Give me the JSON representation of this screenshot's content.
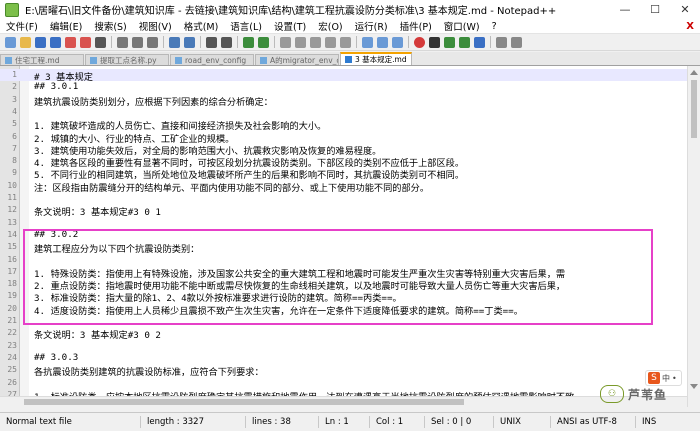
{
  "window": {
    "title": "E:\\居曜石\\旧文件备份\\建筑知识库 - 去链接\\建筑知识库\\结构\\建筑工程抗震设防分类标准\\3  基本规定.md - Notepad++",
    "min": "—",
    "max": "☐",
    "close": "✕"
  },
  "menu": [
    "文件(F)",
    "编辑(E)",
    "搜索(S)",
    "视图(V)",
    "格式(M)",
    "语言(L)",
    "设置(T)",
    "宏(O)",
    "运行(R)",
    "插件(P)",
    "窗口(W)",
    "?"
  ],
  "menu_close": "X",
  "tabs": [
    {
      "label": "住宅工程.md"
    },
    {
      "label": "提取工点名称.py"
    },
    {
      "label": "road_env_config"
    },
    {
      "label": "A的migrator_env_config"
    },
    {
      "label": "3  基本规定.md",
      "active": true
    }
  ],
  "editor": {
    "lines": [
      "# 3 基本规定",
      "## 3.0.1",
      "建筑抗震设防类别划分，应根据下列因素的综合分析确定：",
      "",
      "1. 建筑破坏造成的人员伤亡、直接和间接经济损失及社会影响的大小。",
      "2. 城镇的大小、行业的特点、工矿企业的规模。",
      "3. 建筑使用功能失效后，对全局的影响范围大小、抗震救灾影响及恢复的难易程度。",
      "4. 建筑各区段的重要性有显著不同时，可按区段划分抗震设防类别。下部区段的类别不应低于上部区段。",
      "5. 不同行业的相同建筑，当所处地位及地震破坏所产生的后果和影响不同时，其抗震设防类别可不相同。",
      "注：区段指由防震缝分开的结构单元、平面内使用功能不同的部分、或上下使用功能不同的部分。",
      "",
      "条文说明：3 基本规定#3 0 1",
      "",
      "## 3.0.2",
      "建筑工程应分为以下四个抗震设防类别：",
      "",
      "1. 特殊设防类：指使用上有特殊设施，涉及国家公共安全的重大建筑工程和地震时可能发生严重次生灾害等特别重大灾害后果，需",
      "2. 重点设防类：指地震时使用功能不能中断或需尽快恢复的生命线相关建筑，以及地震时可能导致大量人员伤亡等重大灾害后果，",
      "3. 标准设防类：指大量的除1、2、4款以外按标准要求进行设防的建筑。简称==丙类==。",
      "4. 适度设防类：指使用上人员稀少且震损不致产生次生灾害，允许在一定条件下适度降低要求的建筑。简称==丁类==。",
      "",
      "条文说明：3 基本规定#3 0 2",
      "",
      "## 3.0.3",
      "各抗震设防类别建筑的抗震设防标准，应符合下列要求：",
      "",
      "1. 标准设防类，应按本地区抗震设防烈度确定其抗震措施和地震作用，达到在遭遇高于当地抗震设防烈度的预估罕遇地震影响时不致"
    ]
  },
  "status": {
    "type": "Normal text file",
    "length": "length : 3327",
    "lines": "lines : 38",
    "pos": "Ln : 1",
    "col": "Col : 1",
    "sel": "Sel : 0 | 0",
    "eol": "UNIX",
    "enc": "ANSI as UTF-8",
    "mode": "INS"
  },
  "watermark": {
    "logo": "⚇",
    "text": "芦苇鱼"
  },
  "ime": {
    "icon": "S",
    "lang": "中",
    "extra": "•"
  }
}
